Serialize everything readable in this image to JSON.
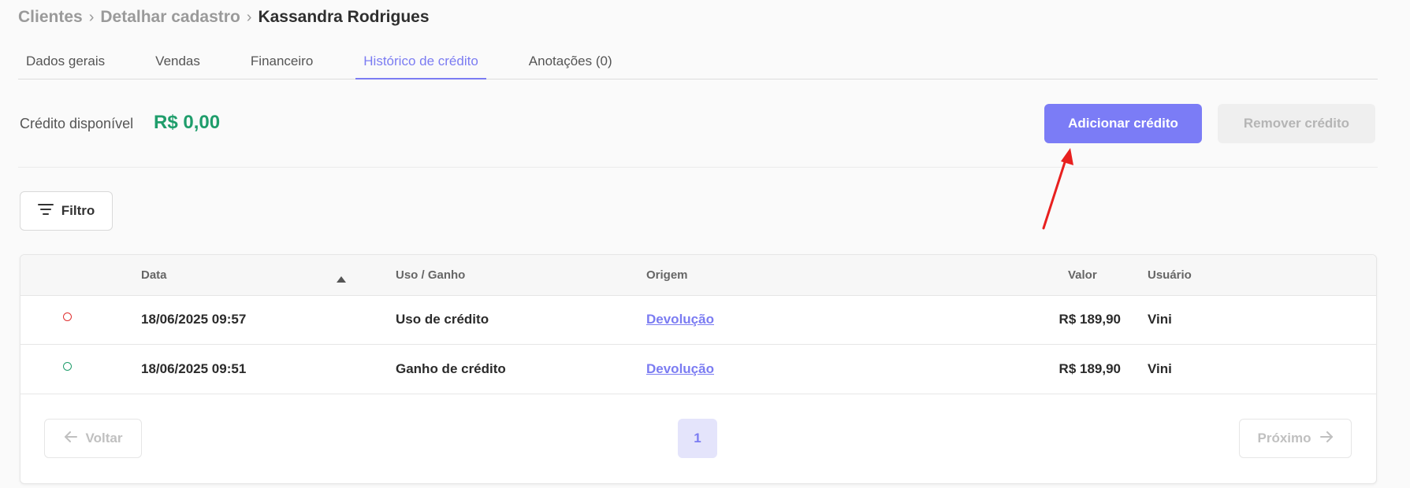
{
  "breadcrumb": {
    "items": [
      "Clientes",
      "Detalhar cadastro",
      "Kassandra Rodrigues"
    ],
    "separator": "›"
  },
  "tabs": [
    {
      "label": "Dados gerais",
      "active": false
    },
    {
      "label": "Vendas",
      "active": false
    },
    {
      "label": "Financeiro",
      "active": false
    },
    {
      "label": "Histórico de crédito",
      "active": true
    },
    {
      "label": "Anotações (0)",
      "active": false
    }
  ],
  "credit": {
    "label": "Crédito disponível",
    "value": "R$ 0,00",
    "value_color": "#1f9d6b"
  },
  "actions": {
    "add_label": "Adicionar crédito",
    "remove_label": "Remover crédito",
    "accent_color": "#7b7cf6"
  },
  "filter": {
    "label": "Filtro",
    "icon": "filter-lines-icon"
  },
  "table": {
    "columns": {
      "date": "Data",
      "type": "Uso / Ganho",
      "origin": "Origem",
      "value": "Valor",
      "user": "Usuário"
    },
    "sort_icon": "sort-up-icon",
    "rows": [
      {
        "status": "uso",
        "status_color": "#e03030",
        "date": "18/06/2025 09:57",
        "type": "Uso de crédito",
        "origin": "Devolução",
        "value": "R$ 189,90",
        "user": "Vini"
      },
      {
        "status": "ganho",
        "status_color": "#1f9d6b",
        "date": "18/06/2025 09:51",
        "type": "Ganho de crédito",
        "origin": "Devolução",
        "value": "R$ 189,90",
        "user": "Vini"
      }
    ]
  },
  "pagination": {
    "prev_label": "Voltar",
    "next_label": "Próximo",
    "current_page": "1"
  },
  "annotation": {
    "arrow_color": "#e8201f"
  }
}
